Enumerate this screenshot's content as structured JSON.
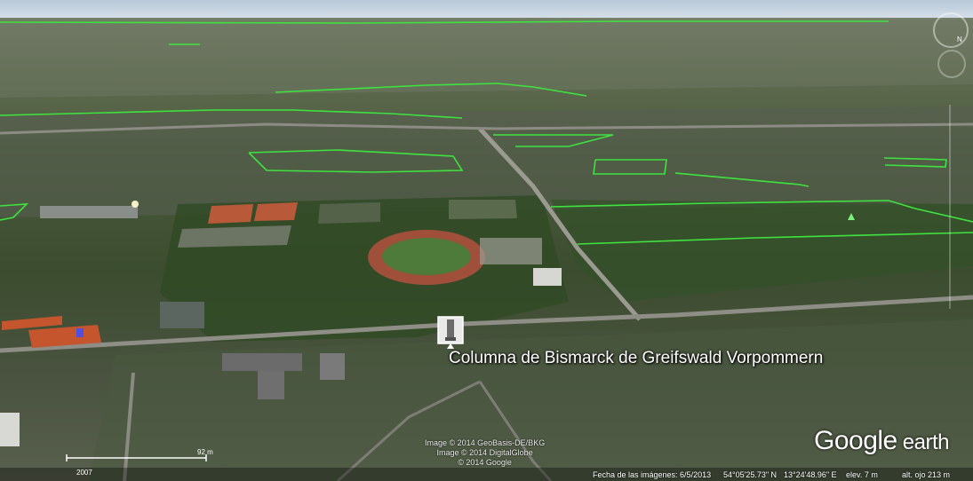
{
  "view": {
    "place_label": "Columna de Bismarck de Greifswald Vorpommern",
    "attribution": [
      "Image © 2014 GeoBasis-DE/BKG",
      "Image © 2014 DigitalGlobe",
      "© 2014 Google"
    ],
    "logo": {
      "brand": "Google",
      "product": "earth"
    },
    "timeline_year": "2007",
    "scale_label": "92 m"
  },
  "status": {
    "imagery_date": "Fecha de las imágenes: 6/5/2013",
    "latitude": "54°05'25.73\" N",
    "longitude": "13°24'48.96\" E",
    "elevation": "elev.   7 m",
    "eye_altitude": "alt. ojo   213 m"
  },
  "colors": {
    "border_lines": "#3ee43e",
    "track": "#a0503a",
    "roof_orange": "#c4552c",
    "label_text": "#ffffff"
  },
  "icons": {
    "compass": "compass-ring-icon",
    "look": "look-joystick-icon",
    "monument": "monument-photo-icon",
    "tree_marker": "tree-marker-icon"
  }
}
